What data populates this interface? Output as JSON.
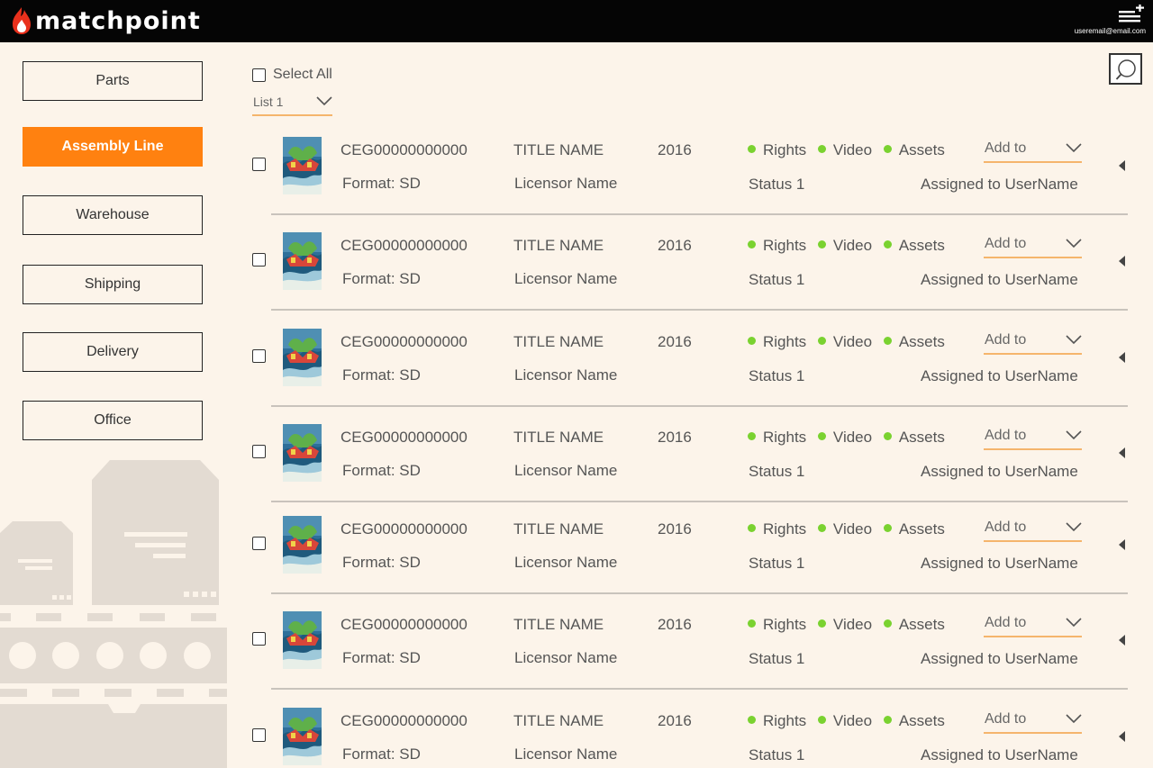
{
  "app": {
    "name": "matchpoint",
    "user_email": "useremail@email.com",
    "accent_color": "#ff8110",
    "status_color": "#7ad230"
  },
  "sidebar": {
    "items": [
      {
        "label": "Parts",
        "active": false
      },
      {
        "label": "Assembly Line",
        "active": true
      },
      {
        "label": "Warehouse",
        "active": false
      },
      {
        "label": "Shipping",
        "active": false
      },
      {
        "label": "Delivery",
        "active": false
      },
      {
        "label": "Office",
        "active": false
      }
    ]
  },
  "main": {
    "select_all_label": "Select All",
    "list_select_value": "List 1",
    "rows": [
      {
        "id": "CEG00000000000",
        "title": "TITLE NAME",
        "year": "2016",
        "format": "Format: SD",
        "licensor": "Licensor Name",
        "tags": [
          "Rights",
          "Video",
          "Assets"
        ],
        "status": "Status 1",
        "add_to": "Add to",
        "assigned": "Assigned to UserName"
      },
      {
        "id": "CEG00000000000",
        "title": "TITLE NAME",
        "year": "2016",
        "format": "Format: SD",
        "licensor": "Licensor Name",
        "tags": [
          "Rights",
          "Video",
          "Assets"
        ],
        "status": "Status 1",
        "add_to": "Add to",
        "assigned": "Assigned to UserName"
      },
      {
        "id": "CEG00000000000",
        "title": "TITLE NAME",
        "year": "2016",
        "format": "Format: SD",
        "licensor": "Licensor Name",
        "tags": [
          "Rights",
          "Video",
          "Assets"
        ],
        "status": "Status 1",
        "add_to": "Add to",
        "assigned": "Assigned to UserName"
      },
      {
        "id": "CEG00000000000",
        "title": "TITLE NAME",
        "year": "2016",
        "format": "Format: SD",
        "licensor": "Licensor Name",
        "tags": [
          "Rights",
          "Video",
          "Assets"
        ],
        "status": "Status 1",
        "add_to": "Add to",
        "assigned": "Assigned to UserName"
      },
      {
        "id": "CEG00000000000",
        "title": "TITLE NAME",
        "year": "2016",
        "format": "Format: SD",
        "licensor": "Licensor Name",
        "tags": [
          "Rights",
          "Video",
          "Assets"
        ],
        "status": "Status 1",
        "add_to": "Add to",
        "assigned": "Assigned to UserName"
      },
      {
        "id": "CEG00000000000",
        "title": "TITLE NAME",
        "year": "2016",
        "format": "Format: SD",
        "licensor": "Licensor Name",
        "tags": [
          "Rights",
          "Video",
          "Assets"
        ],
        "status": "Status 1",
        "add_to": "Add to",
        "assigned": "Assigned to UserName"
      },
      {
        "id": "CEG00000000000",
        "title": "TITLE NAME",
        "year": "2016",
        "format": "Format: SD",
        "licensor": "Licensor Name",
        "tags": [
          "Rights",
          "Video",
          "Assets"
        ],
        "status": "Status 1",
        "add_to": "Add to",
        "assigned": "Assigned to UserName"
      }
    ]
  }
}
